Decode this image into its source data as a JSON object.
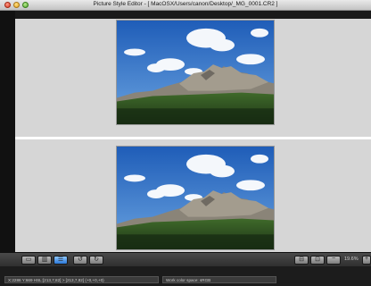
{
  "window": {
    "title": "Picture Style Editor - [ MacOSX/Users/canon/Desktop/_MG_0001.CR2 ]"
  },
  "toolbar": {
    "buttons": [
      {
        "name": "single-view-button",
        "glyph": "▭"
      },
      {
        "name": "side-by-side-view-button",
        "glyph": "▥"
      },
      {
        "name": "top-bottom-view-button",
        "glyph": "☰"
      },
      {
        "name": "rotate-left-button",
        "glyph": "↺"
      },
      {
        "name": "rotate-right-button",
        "glyph": "↻"
      }
    ],
    "right_buttons": [
      {
        "name": "fit-to-window-button",
        "glyph": "⊟"
      },
      {
        "name": "actual-size-button",
        "glyph": "⊡"
      },
      {
        "name": "zoom-out-button",
        "glyph": "−"
      }
    ],
    "zoom_value": "19.6%",
    "zoom_in_glyph": "+"
  },
  "statusbar": {
    "pixel_info": "X:2286 Y:669  HSL:[213,7,82] > [213,7,82]  (+0,+0,+0)",
    "color_space": "Work color space: sRGB"
  },
  "colors": {
    "active_button": "#2a77d6",
    "pane_background": "#d6d6d6"
  }
}
